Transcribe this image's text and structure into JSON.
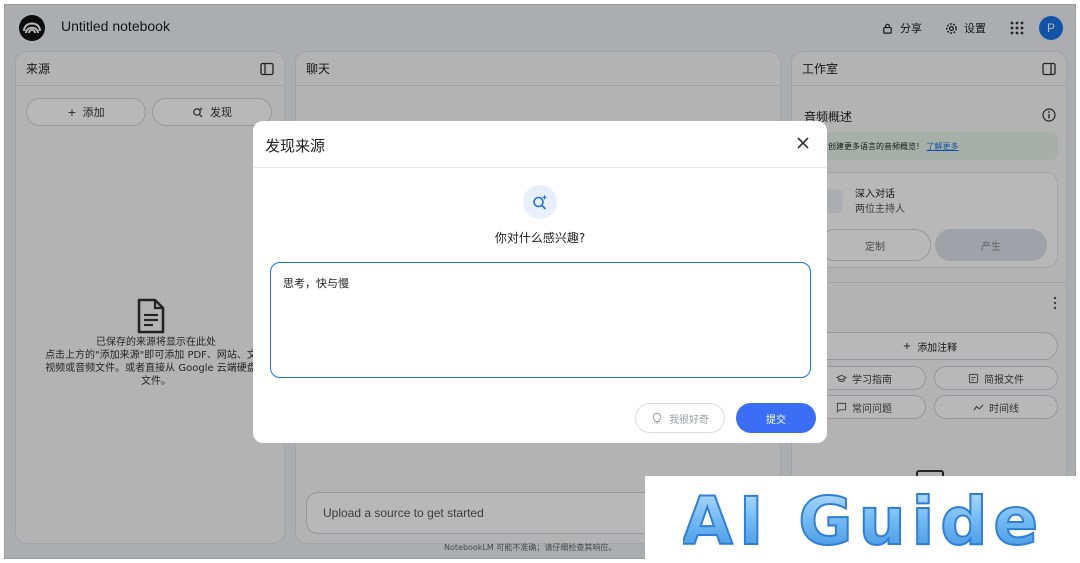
{
  "header": {
    "title": "Untitled notebook",
    "share_label": "分享",
    "settings_label": "设置",
    "avatar_initial": "P"
  },
  "sources": {
    "title": "来源",
    "add_label": "添加",
    "discover_label": "发现",
    "empty_text": "已保存的来源将显示在此处\n点击上方的\"添加来源\"即可添加 PDF、网站、文本\n视频或音频文件。或者直接从 Google 云端硬盘导\n文件。"
  },
  "chat": {
    "title": "聊天",
    "input_placeholder": "Upload a source to get started",
    "footer_note": "NotebookLM 可能不准确；请仔细检查其响应。"
  },
  "studio": {
    "title": "工作室",
    "audio_overview": "音频概述",
    "banner_text": "创建更多语言的音频概览！",
    "banner_link": "了解更多",
    "deep_dive_title": "深入对话",
    "deep_dive_sub": "两位主持人",
    "customize_label": "定制",
    "generate_label": "产生",
    "add_note_label": "添加注释",
    "study_guide": "学习指南",
    "briefing_doc": "简报文件",
    "faq": "常问问题",
    "timeline": "时间线"
  },
  "modal": {
    "title": "发现来源",
    "question": "你对什么感兴趣?",
    "input_value": "思考，快与慢",
    "curious_label": "我很好奇",
    "submit_label": "提交"
  },
  "watermark": {
    "text": "AI Guide"
  },
  "colors": {
    "accent": "#1a73e8",
    "submit": "#3b6ef6",
    "banner_bg": "#e6f4ea",
    "watermark_fill": "#7fc3f5"
  }
}
